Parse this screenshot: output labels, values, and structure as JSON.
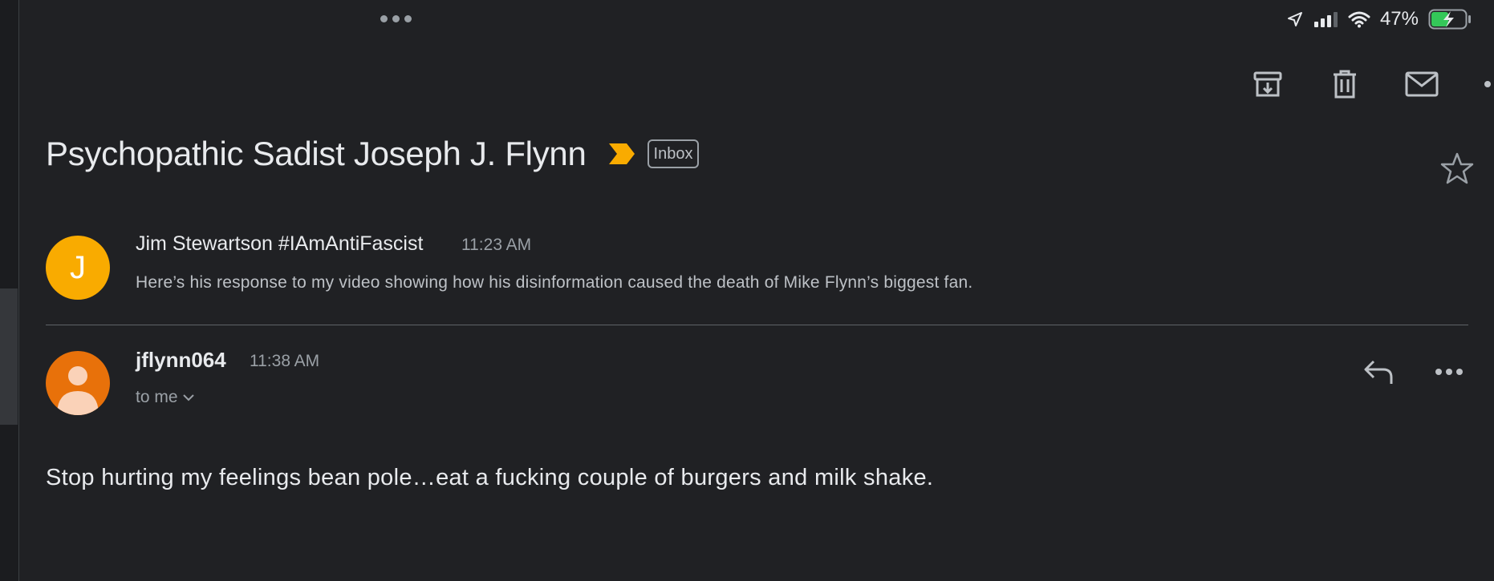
{
  "status_bar": {
    "battery_percent": "47%",
    "icons": [
      "location-arrow-icon",
      "cellular-signal-icon",
      "wifi-icon",
      "battery-charging-icon"
    ]
  },
  "toolbar": {
    "icons": [
      "archive-icon",
      "trash-icon",
      "mark-unread-icon",
      "more-icon"
    ]
  },
  "email": {
    "subject": "Psychopathic Sadist Joseph J. Flynn",
    "label_chip": "Inbox",
    "importance_color": "#f9ab00"
  },
  "messages": [
    {
      "avatar_letter": "J",
      "avatar_color": "#f9ab00",
      "sender": "Jim Stewartson #IAmAntiFascist",
      "time": "11:23 AM",
      "snippet": "Here’s his response to my video showing how his disinformation caused the death of Mike Flynn’s biggest fan."
    },
    {
      "avatar_color": "#e8710a",
      "sender": "jflynn064",
      "time": "11:38 AM",
      "recipient": "to me",
      "body": "Stop hurting my feelings bean pole…eat a fucking couple of burgers and milk shake."
    }
  ]
}
